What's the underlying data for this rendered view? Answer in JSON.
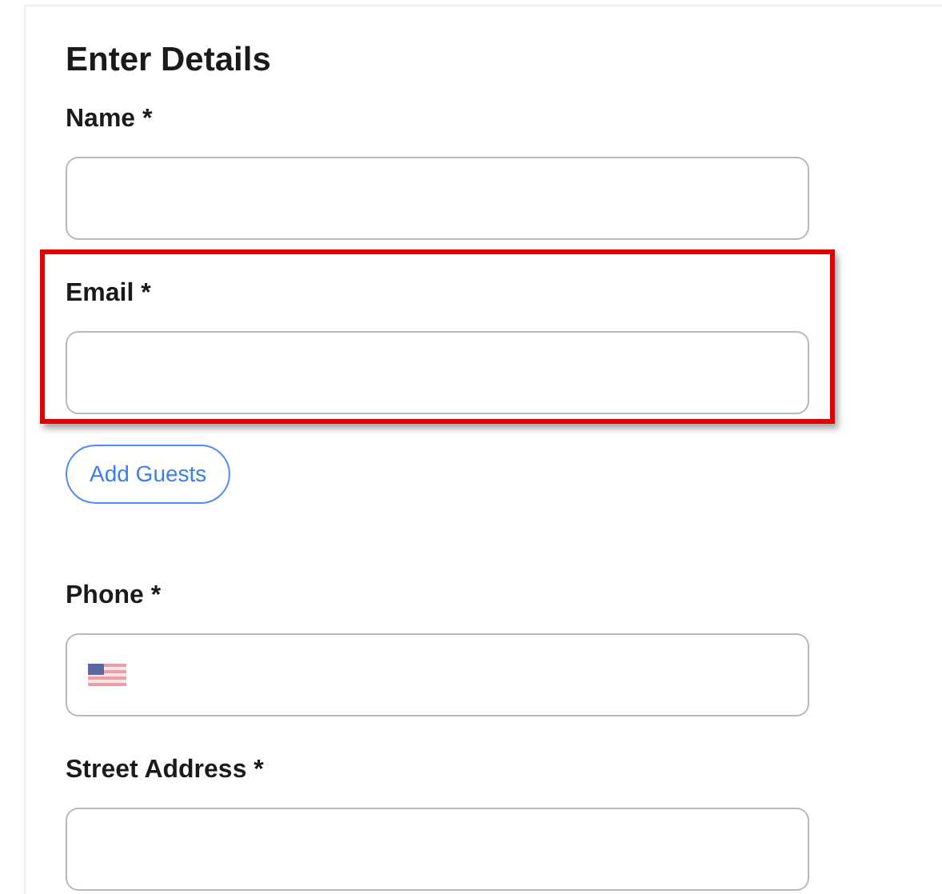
{
  "title": "Enter Details",
  "fields": [
    {
      "kind": "text",
      "label": "Name *",
      "highlighted": false
    },
    {
      "kind": "text",
      "label": "Email *",
      "highlighted": true
    },
    {
      "kind": "button",
      "label": "Add Guests"
    },
    {
      "kind": "phone",
      "label": "Phone *",
      "highlighted": false
    },
    {
      "kind": "text",
      "label": "Street Address *",
      "highlighted": false
    }
  ]
}
